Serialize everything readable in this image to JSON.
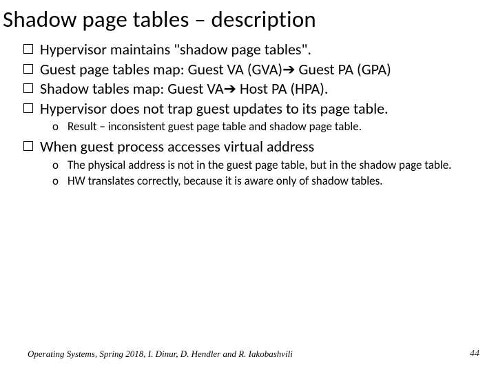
{
  "title": "Shadow page tables – description",
  "bullets": {
    "b0": "Hypervisor maintains \"shadow page tables\".",
    "b1_pre": "Guest page tables map: Guest VA (GVA)",
    "b1_post": " Guest PA (GPA)",
    "b2_pre": "Shadow tables map: Guest VA",
    "b2_post": " Host PA (HPA).",
    "b3": "Hypervisor does not trap guest updates to its page table.",
    "b3_sub0": "Result – inconsistent guest page table and shadow page table.",
    "b4": "When guest process accesses virtual address",
    "b4_sub0": "The physical address is not in the guest page table, but in the shadow page table.",
    "b4_sub1": "HW translates correctly, because it is aware only of shadow tables."
  },
  "arrow": "➔",
  "sub_marker": "o",
  "footer": "Operating Systems, Spring 2018, I. Dinur, D. Hendler and R. Iakobashvili",
  "page_number": "44"
}
